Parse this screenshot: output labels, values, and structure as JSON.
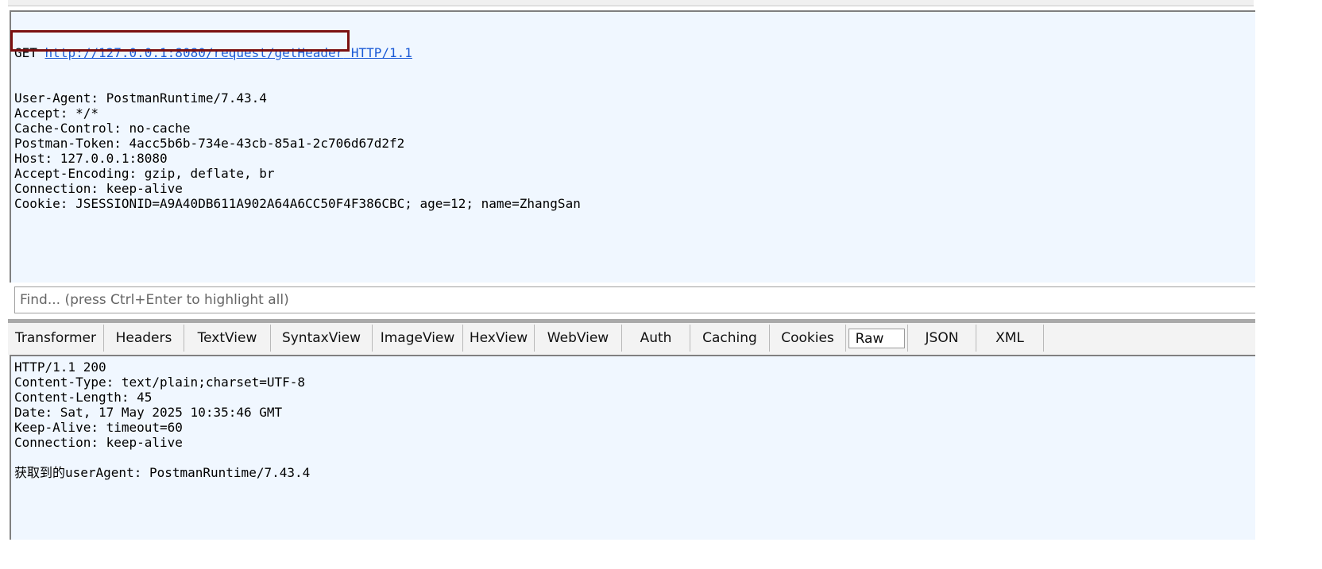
{
  "request": {
    "method": "GET",
    "url": "http://127.0.0.1:8080/request/getHeader",
    "protocol": "HTTP/1.1",
    "headers": [
      "User-Agent: PostmanRuntime/7.43.4",
      "Accept: */*",
      "Cache-Control: no-cache",
      "Postman-Token: 4acc5b6b-734e-43cb-85a1-2c706d67d2f2",
      "Host: 127.0.0.1:8080",
      "Accept-Encoding: gzip, deflate, br",
      "Connection: keep-alive",
      "Cookie: JSESSIONID=A9A40DB611A902A64A6CC50F4F386CBC; age=12; name=ZhangSan"
    ]
  },
  "find": {
    "placeholder": "Find... (press Ctrl+Enter to highlight all)"
  },
  "tabs": [
    {
      "label": "Transformer",
      "active": false
    },
    {
      "label": "Headers",
      "active": false
    },
    {
      "label": "TextView",
      "active": false
    },
    {
      "label": "SyntaxView",
      "active": false
    },
    {
      "label": "ImageView",
      "active": false
    },
    {
      "label": "HexView",
      "active": false
    },
    {
      "label": "WebView",
      "active": false
    },
    {
      "label": "Auth",
      "active": false
    },
    {
      "label": "Caching",
      "active": false
    },
    {
      "label": "Cookies",
      "active": false
    },
    {
      "label": "Raw",
      "active": true
    },
    {
      "label": "JSON",
      "active": false
    },
    {
      "label": "XML",
      "active": false
    }
  ],
  "response": {
    "lines": [
      "HTTP/1.1 200",
      "Content-Type: text/plain;charset=UTF-8",
      "Content-Length: 45",
      "Date: Sat, 17 May 2025 10:35:46 GMT",
      "Keep-Alive: timeout=60",
      "Connection: keep-alive",
      "",
      "获取到的userAgent: PostmanRuntime/7.43.4"
    ]
  },
  "colors": {
    "highlight_box": "#7b1010",
    "link": "#1a5ad6",
    "pane_bg": "#f0f7ff"
  }
}
